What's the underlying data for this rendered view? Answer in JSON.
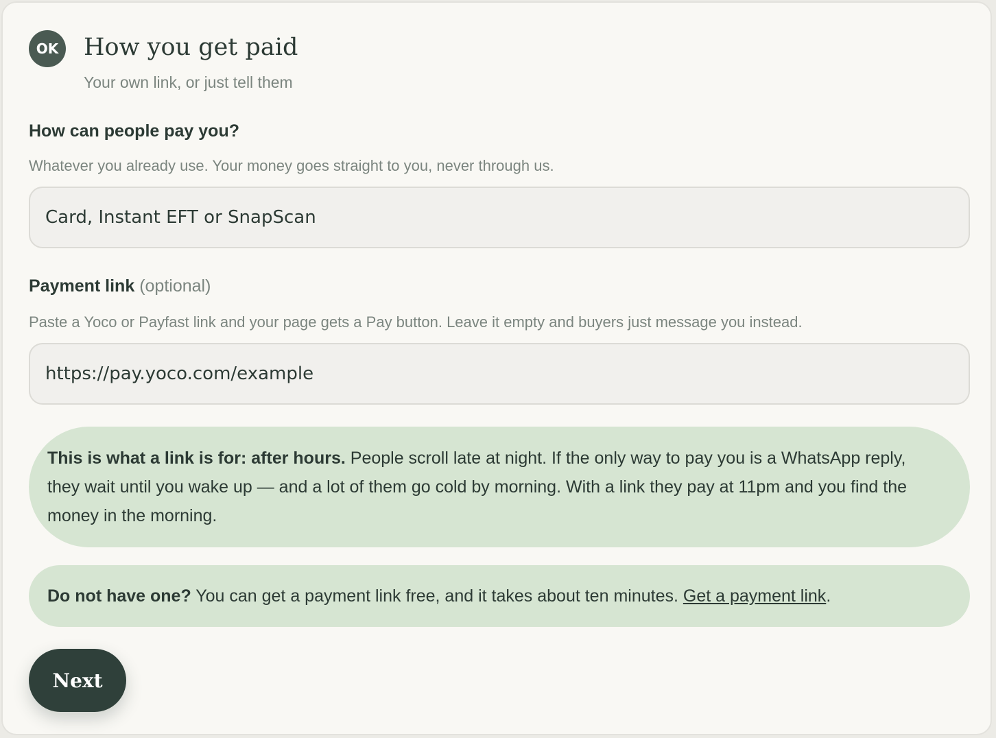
{
  "header": {
    "badge": "OK",
    "title": "How you get paid",
    "subtitle": "Your own link, or just tell them"
  },
  "pay_methods": {
    "label": "How can people pay you?",
    "help": "Whatever you already use. Your money goes straight to you, never through us.",
    "value": "Card, Instant EFT or SnapScan"
  },
  "payment_link": {
    "label": "Payment link",
    "optional": "(optional)",
    "help": "Paste a Yoco or Payfast link and your page gets a Pay button. Leave it empty and buyers just message you instead.",
    "value": "https://pay.yoco.com/example"
  },
  "after_hours_note": {
    "heading": "This is what a link is for: after hours.",
    "body": "People scroll late at night. If the only way to pay you is a WhatsApp reply, they wait until you wake up — and a lot of them go cold by morning. With a link they pay at 11pm and you find the money in the morning."
  },
  "no_link_note": {
    "heading": "Do not have one?",
    "body": "You can get a payment link free, and it takes about ten minutes.",
    "link_text": "Get a payment link",
    "trailing": "."
  },
  "actions": {
    "next_label": "Next"
  },
  "colors": {
    "card_background": "#f9f8f4",
    "badge": "#4a5a52",
    "input_background": "#f1f0ed",
    "note_background": "#d6e5d2",
    "primary_button": "#2f403a",
    "text_primary": "#2c3a34",
    "text_muted": "#7b857f"
  }
}
